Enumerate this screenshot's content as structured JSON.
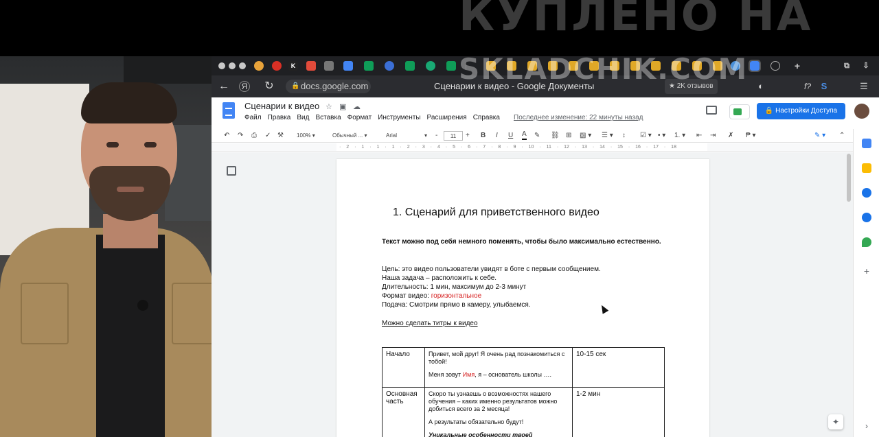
{
  "overlay": {
    "title": "КУПЛЕНО НА",
    "watermark": "SKLADCHIK.COM"
  },
  "browser": {
    "url": "docs.google.com",
    "window_title": "Сценарии к видео - Google Документы",
    "reviews_badge": "★ 2K отзывов",
    "nav_icons": [
      "back-icon",
      "yandex-icon",
      "reload-icon"
    ]
  },
  "docs": {
    "title": "Сценарии к видео",
    "menu": [
      "Файл",
      "Правка",
      "Вид",
      "Вставка",
      "Формат",
      "Инструменты",
      "Расширения",
      "Справка"
    ],
    "last_edit": "Последнее изменение: 22 минуты назад",
    "share_label": "Настройки Доступа"
  },
  "toolbar": {
    "zoom": "100%",
    "style": "Обычный ...",
    "font": "Arial",
    "font_size": "11",
    "minus": "-",
    "plus": "+",
    "bold": "B",
    "italic": "I",
    "underline": "U",
    "text_color": "A",
    "ruler": "· 2 · 1 · 1 · 1 · 2 · 3 · 4 · 5 · 6 · 7 · 8 · 9 · 10 · 11 · 12 · 13 · 14 · 15 · 16 · 17 · 18"
  },
  "document": {
    "heading": "1. Сценарий для приветственного видео",
    "subhead": "Текст можно под себя немного поменять, чтобы было максимально естественно.",
    "lines": [
      "Цель: это видео пользователи увидят в боте с первым сообщением.",
      "Наша задача – расположить к себе.",
      "Длительность: 1 мин, максимум до 2-3 минут",
      "Подача: Смотрим прямо в камеру, улыбаемся."
    ],
    "format_label": "Формат видео: ",
    "format_value": "горизонтальное",
    "titles_note": "Можно сделать титры к видео",
    "table": {
      "row1": {
        "section": "Начало",
        "text1": "Привет, мой друг! Я очень рад познакомиться с тобой!",
        "text2_a": "Меня зовут ",
        "text2_name": "Имя",
        "text2_b": ", я – основатель школы ….",
        "duration": "10-15 сек"
      },
      "row2": {
        "section": "Основная часть",
        "text1": "Скоро ты узнаешь о возможностях нашего обучения – каких именно результатов можно добиться всего за 2 месяца!",
        "text2": "А результаты обязательно будут!",
        "text3": "Уникальные особенности твоей",
        "duration": "1-2 мин"
      }
    }
  },
  "colors": {
    "share_button": "#1a73e8",
    "accent_red": "#d61f1f",
    "browser_chrome": "#1f2023"
  }
}
